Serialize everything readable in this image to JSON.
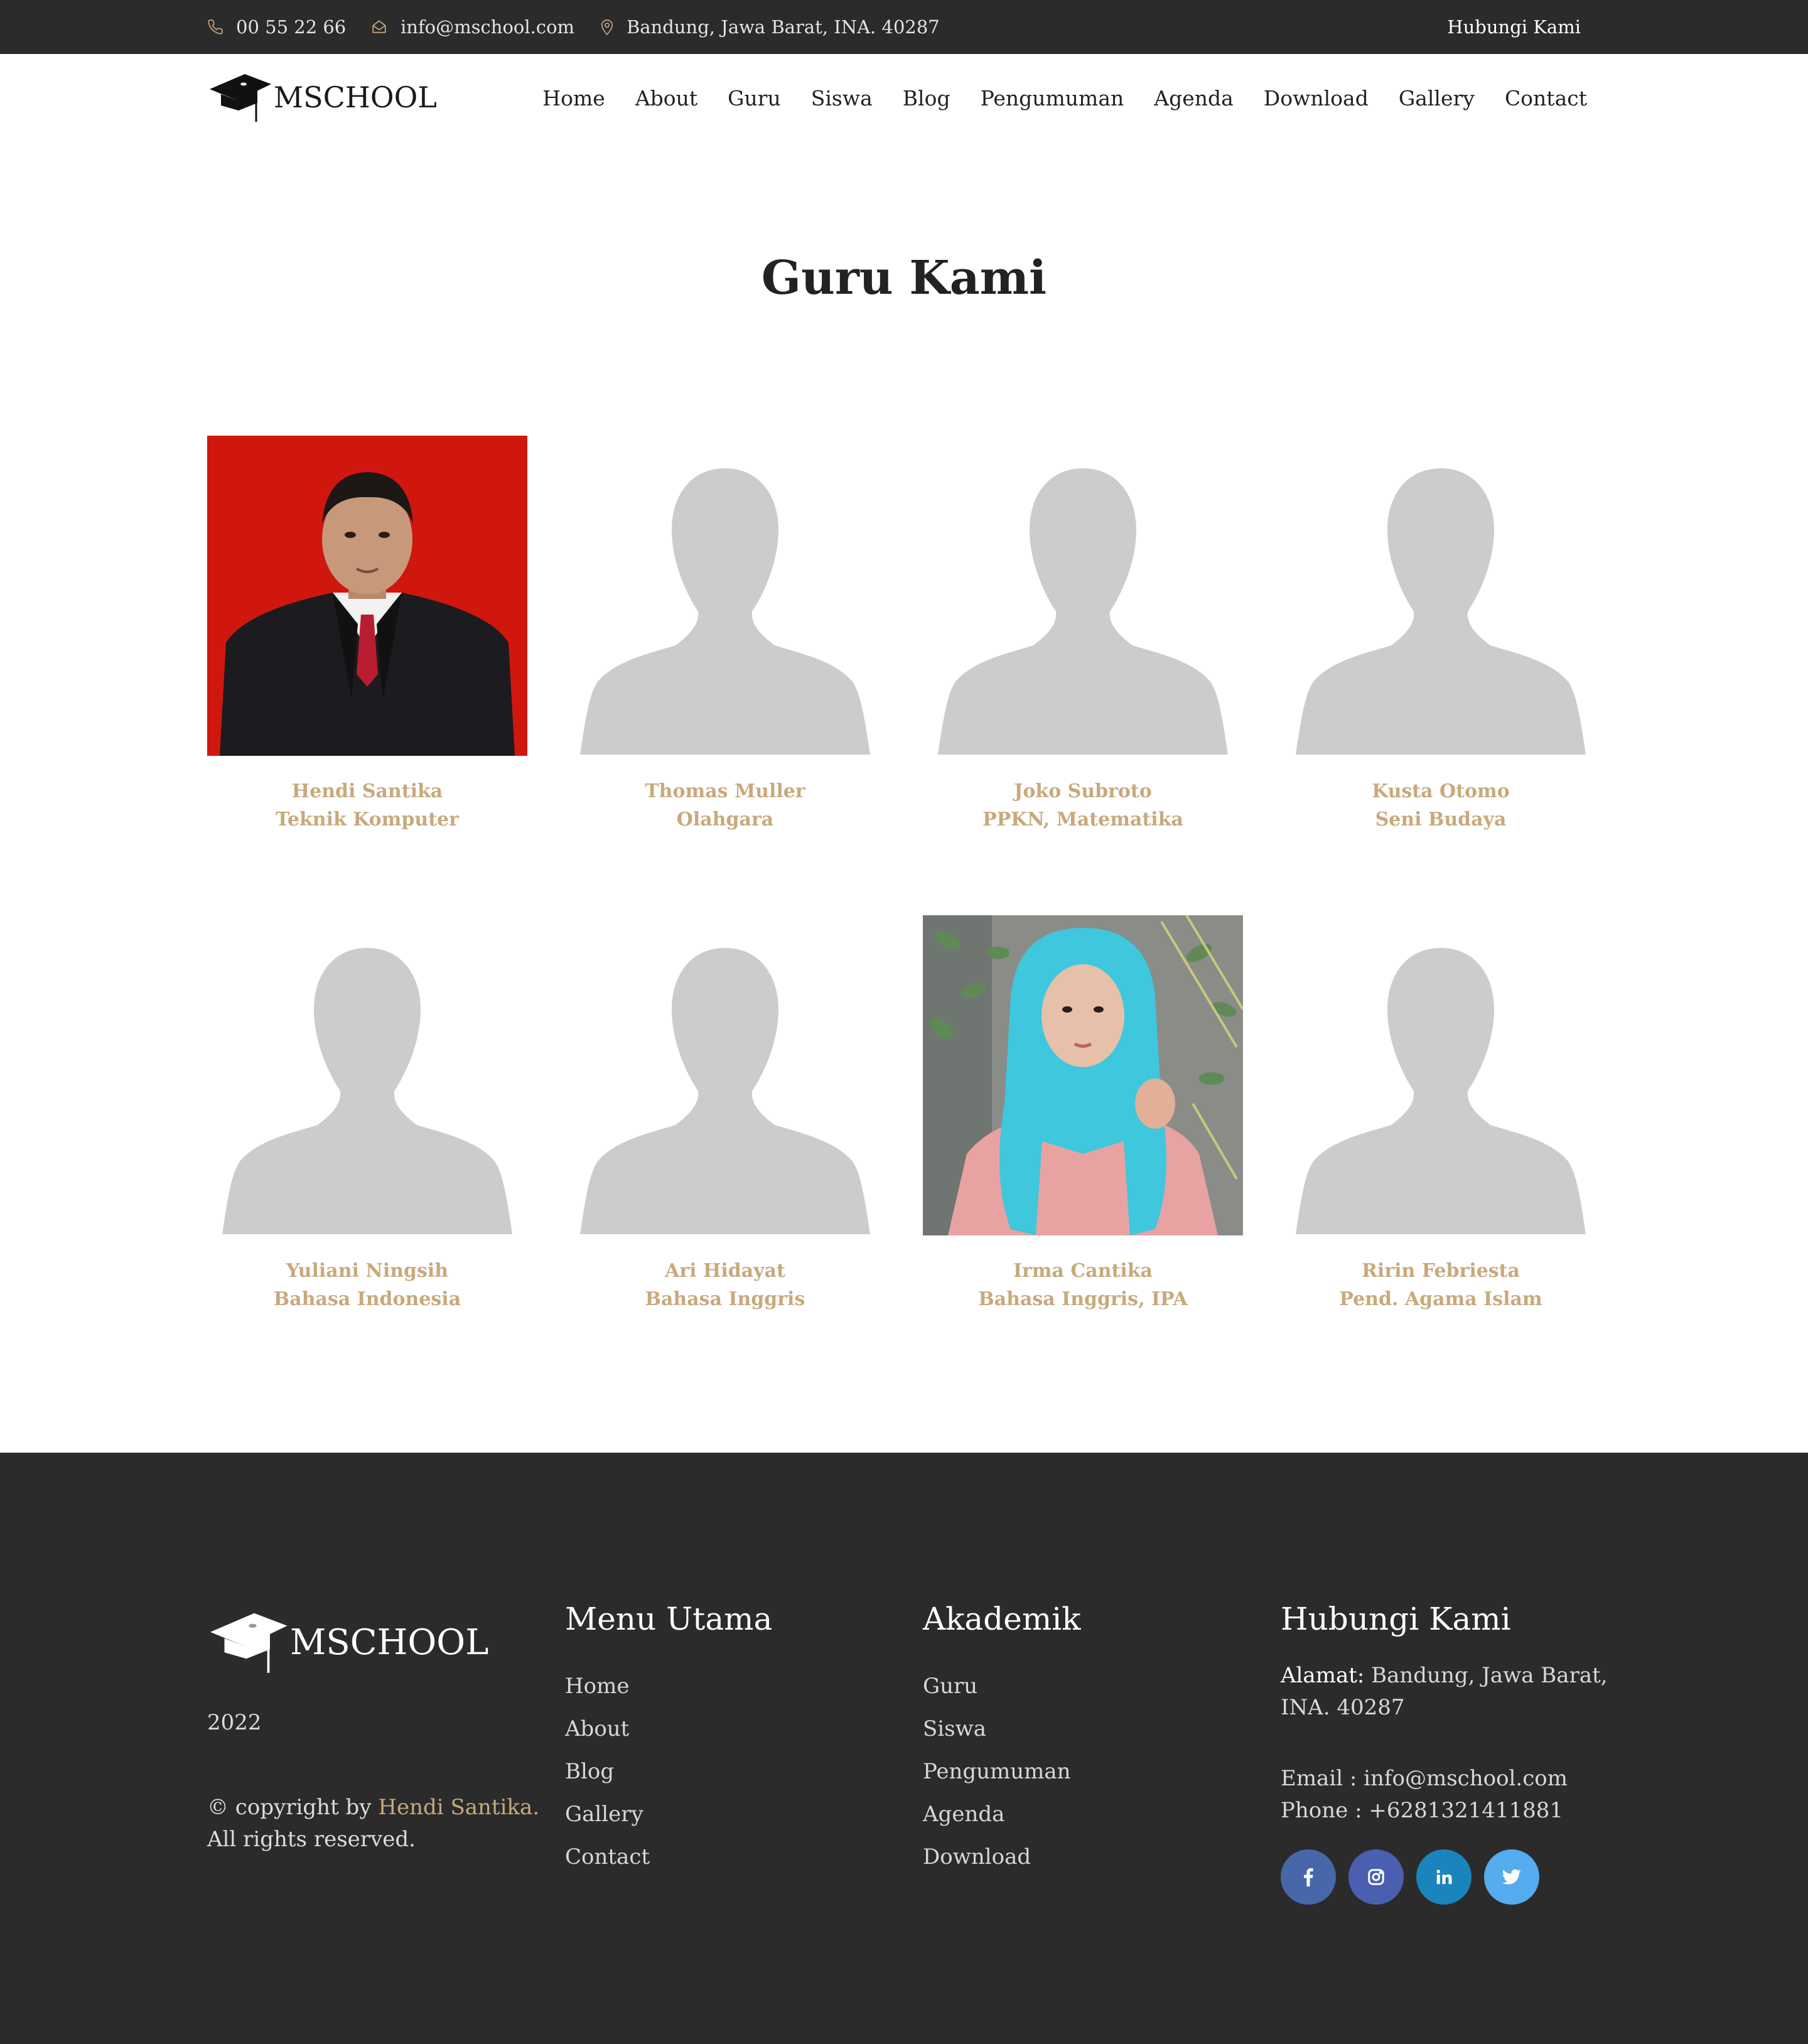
{
  "topbar": {
    "phone": "00 55 22 66",
    "email": "info@mschool.com",
    "address": "Bandung, Jawa Barat, INA. 40287",
    "contact_link": "Hubungi Kami"
  },
  "brand": {
    "name": "MSCHOOL"
  },
  "nav": {
    "items": [
      "Home",
      "About",
      "Guru",
      "Siswa",
      "Blog",
      "Pengumuman",
      "Agenda",
      "Download",
      "Gallery",
      "Contact"
    ]
  },
  "page": {
    "title": "Guru Kami"
  },
  "teachers": [
    {
      "name": "Hendi Santika",
      "subject": "Teknik Komputer",
      "photo": "photo"
    },
    {
      "name": "Thomas Muller",
      "subject": "Olahgara",
      "photo": "placeholder-silhouette"
    },
    {
      "name": "Joko Subroto",
      "subject": "PPKN, Matematika",
      "photo": "placeholder-silhouette"
    },
    {
      "name": "Kusta Otomo",
      "subject": "Seni Budaya",
      "photo": "placeholder-silhouette"
    },
    {
      "name": "Yuliani Ningsih",
      "subject": "Bahasa Indonesia",
      "photo": "placeholder-silhouette"
    },
    {
      "name": "Ari Hidayat",
      "subject": "Bahasa Inggris",
      "photo": "placeholder-silhouette"
    },
    {
      "name": "Irma Cantika",
      "subject": "Bahasa Inggris, IPA",
      "photo": "photo"
    },
    {
      "name": "Ririn Febriesta",
      "subject": "Pend. Agama Islam",
      "photo": "placeholder-silhouette"
    }
  ],
  "footer": {
    "brand": "MSCHOOL",
    "year": "2022",
    "copyright_prefix": "© copyright by ",
    "copyright_author": "Hendi Santika.",
    "rights": "All rights reserved.",
    "menu_title": "Menu Utama",
    "menu_items": [
      "Home",
      "About",
      "Blog",
      "Gallery",
      "Contact"
    ],
    "academic_title": "Akademik",
    "academic_items": [
      "Guru",
      "Siswa",
      "Pengumuman",
      "Agenda",
      "Download"
    ],
    "contact_title": "Hubungi Kami",
    "address_label": "Alamat:",
    "address_value": " Bandung, Jawa Barat, INA. 40287",
    "email_line": "Email : info@mschool.com",
    "phone_line": "Phone : +6281321411881",
    "socials": [
      {
        "name": "facebook",
        "color": "#4867aa"
      },
      {
        "name": "instagram",
        "color": "#4a5fb0"
      },
      {
        "name": "linkedin",
        "color": "#1a84bc"
      },
      {
        "name": "twitter",
        "color": "#55acee"
      }
    ]
  },
  "colors": {
    "accent": "#c8a97c",
    "dark": "#2b2b2b"
  }
}
